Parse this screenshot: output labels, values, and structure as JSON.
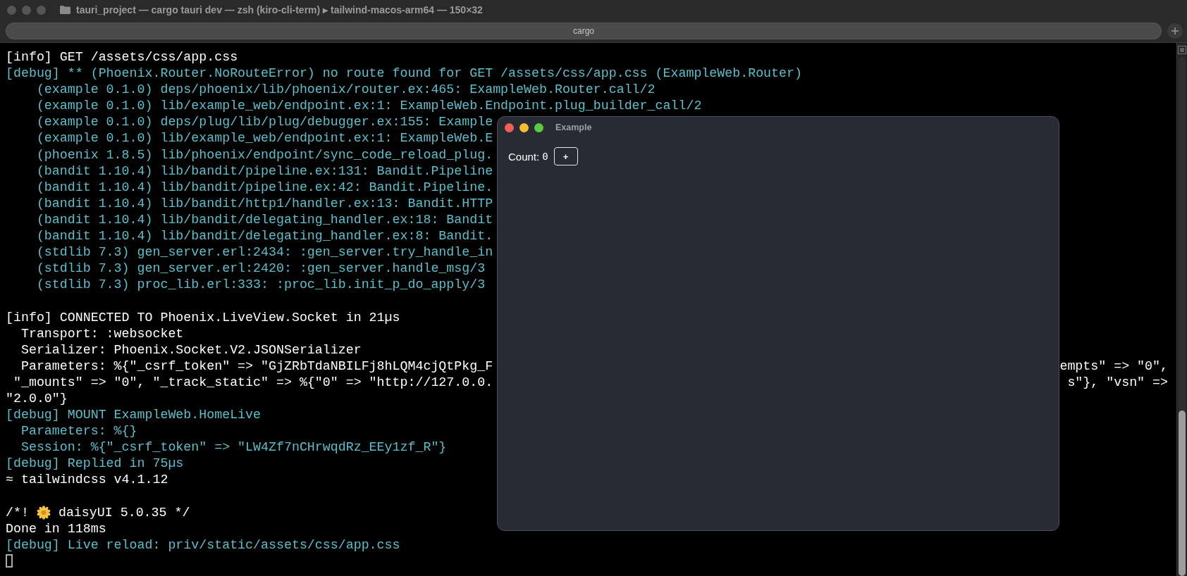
{
  "window": {
    "title": "tauri_project — cargo tauri dev — zsh (kiro-cli-term) ▸ tailwind-macos-arm64 — 150×32"
  },
  "tabs": [
    {
      "label": "cargo",
      "selected": true
    }
  ],
  "lines": [
    {
      "kind": "text",
      "color": "#ffffff",
      "text": "[info] GET /assets/css/app.css"
    },
    {
      "kind": "text",
      "color": "#5cbfcc",
      "text": "[debug] ** (Phoenix.Router.NoRouteError) no route found for GET /assets/css/app.css (ExampleWeb.Router)"
    },
    {
      "kind": "text",
      "color": "#5cbfcc",
      "text": "    (example 0.1.0) deps/phoenix/lib/phoenix/router.ex:465: ExampleWeb.Router.call/2"
    },
    {
      "kind": "text",
      "color": "#5cbfcc",
      "text": "    (example 0.1.0) lib/example_web/endpoint.ex:1: ExampleWeb.Endpoint.plug_builder_call/2"
    },
    {
      "kind": "text",
      "color": "#5cbfcc",
      "text": "    (example 0.1.0) deps/plug/lib/plug/debugger.ex:155: Example"
    },
    {
      "kind": "text",
      "color": "#5cbfcc",
      "text": "    (example 0.1.0) lib/example_web/endpoint.ex:1: ExampleWeb.E"
    },
    {
      "kind": "text",
      "color": "#5cbfcc",
      "text": "    (phoenix 1.8.5) lib/phoenix/endpoint/sync_code_reload_plug."
    },
    {
      "kind": "text",
      "color": "#5cbfcc",
      "text": "    (bandit 1.10.4) lib/bandit/pipeline.ex:131: Bandit.Pipeline"
    },
    {
      "kind": "text",
      "color": "#5cbfcc",
      "text": "    (bandit 1.10.4) lib/bandit/pipeline.ex:42: Bandit.Pipeline."
    },
    {
      "kind": "text",
      "color": "#5cbfcc",
      "text": "    (bandit 1.10.4) lib/bandit/http1/handler.ex:13: Bandit.HTTP"
    },
    {
      "kind": "text",
      "color": "#5cbfcc",
      "text": "    (bandit 1.10.4) lib/bandit/delegating_handler.ex:18: Bandit"
    },
    {
      "kind": "text",
      "color": "#5cbfcc",
      "text": "    (bandit 1.10.4) lib/bandit/delegating_handler.ex:8: Bandit."
    },
    {
      "kind": "text",
      "color": "#5cbfcc",
      "text": "    (stdlib 7.3) gen_server.erl:2434: :gen_server.try_handle_in"
    },
    {
      "kind": "text",
      "color": "#5cbfcc",
      "text": "    (stdlib 7.3) gen_server.erl:2420: :gen_server.handle_msg/3"
    },
    {
      "kind": "text",
      "color": "#5cbfcc",
      "text": "    (stdlib 7.3) proc_lib.erl:333: :proc_lib.init_p_do_apply/3"
    },
    {
      "kind": "blank"
    },
    {
      "kind": "text",
      "color": "#ffffff",
      "text": "[info] CONNECTED TO Phoenix.LiveView.Socket in 21µs"
    },
    {
      "kind": "text",
      "color": "#ffffff",
      "text": "  Transport: :websocket"
    },
    {
      "kind": "text",
      "color": "#ffffff",
      "text": "  Serializer: Phoenix.Socket.V2.JSONSerializer"
    },
    {
      "kind": "text",
      "color": "#ffffff",
      "text": "  Parameters: %{\"_csrf_token\" => \"GjZRbTdaNBILFj8hLQM4cjQtPkg_F",
      "right": "empts\" => \"0\","
    },
    {
      "kind": "text",
      "color": "#ffffff",
      "text": " \"_mounts\" => \"0\", \"_track_static\" => %{\"0\" => \"http://127.0.0.",
      "right": "s\"}, \"vsn\" =>"
    },
    {
      "kind": "text",
      "color": "#ffffff",
      "text": "\"2.0.0\"}"
    },
    {
      "kind": "text",
      "color": "#5cbfcc",
      "text": "[debug] MOUNT ExampleWeb.HomeLive"
    },
    {
      "kind": "text",
      "color": "#5cbfcc",
      "text": "  Parameters: %{}"
    },
    {
      "kind": "text",
      "color": "#5cbfcc",
      "text": "  Session: %{\"_csrf_token\" => \"LW4Zf7nCHrwqdRz_EEy1zf_R\"}"
    },
    {
      "kind": "text",
      "color": "#5cbfcc",
      "text": "[debug] Replied in 75µs"
    },
    {
      "kind": "text",
      "color": "#ffffff",
      "text": "≈ tailwindcss v4.1.12"
    },
    {
      "kind": "blank"
    },
    {
      "kind": "flower",
      "color": "#ffffff",
      "text": "/*!",
      "text_after": "daisyUI 5.0.35 */"
    },
    {
      "kind": "text",
      "color": "#ffffff",
      "text": "Done in 118ms"
    },
    {
      "kind": "text",
      "color": "#5cbfcc",
      "text": "[debug] Live reload: priv/static/assets/css/app.css"
    },
    {
      "kind": "cursor"
    }
  ],
  "app_window": {
    "title": "Example",
    "count_label": "Count:",
    "count": "0",
    "button": "+"
  }
}
